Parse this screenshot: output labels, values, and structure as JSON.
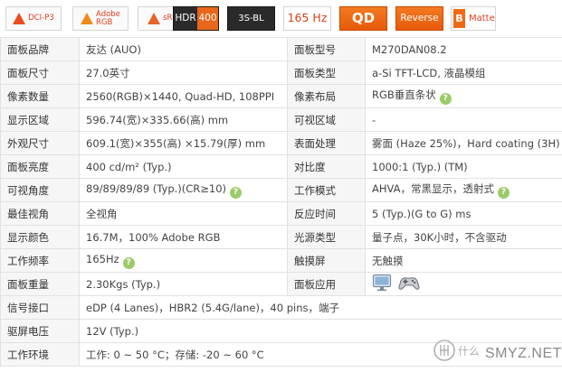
{
  "badges": {
    "dci_p3": "DCI-P3",
    "adobe_rgb_line1": "Adobe",
    "adobe_rgb_line2": "RGB",
    "srgb": "sRGB",
    "hdr_a": "HDR",
    "hdr_b": "400",
    "bl": "3S-BL",
    "hz": "165 Hz",
    "qd": "QD",
    "reverse": "Reverse",
    "matte_letter": "B",
    "matte": "Matte"
  },
  "specs": {
    "rows": [
      {
        "l1": "面板品牌",
        "v1": "友达 (AUO)",
        "l2": "面板型号",
        "v2": "M270DAN08.2"
      },
      {
        "l1": "面板尺寸",
        "v1": "27.0英寸",
        "l2": "面板类型",
        "v2": "a-Si TFT-LCD, 液晶模组"
      },
      {
        "l1": "像素数量",
        "v1": "2560(RGB)×1440, Quad-HD, 108PPI",
        "l2": "像素布局",
        "v2": "RGB垂直条状"
      },
      {
        "l1": "显示区域",
        "v1": "596.74(宽)×335.66(高) mm",
        "l2": "可视区域",
        "v2": "-"
      },
      {
        "l1": "外观尺寸",
        "v1": "609.1(宽)×355(高) ×15.79(厚) mm",
        "l2": "表面处理",
        "v2": "雾面 (Haze 25%)，Hard coating (3H)"
      },
      {
        "l1": "面板亮度",
        "v1": "400 cd/m² (Typ.)",
        "l2": "对比度",
        "v2": "1000:1 (Typ.) (TM)"
      },
      {
        "l1": "可视角度",
        "v1": "89/89/89/89 (Typ.)(CR≥10)",
        "l2": "工作模式",
        "v2": "AHVA，常黑显示，透射式"
      },
      {
        "l1": "最佳视角",
        "v1": "全视角",
        "l2": "反应时间",
        "v2": "5 (Typ.)(G to G) ms"
      },
      {
        "l1": "显示颜色",
        "v1": "16.7M，100% Adobe RGB",
        "l2": "光源类型",
        "v2": "量子点，30K小时，不含驱动"
      },
      {
        "l1": "工作频率",
        "v1": "165Hz",
        "l2": "触摸屏",
        "v2": "无触摸"
      },
      {
        "l1": "面板重量",
        "v1": "2.30Kgs (Typ.)",
        "l2": "面板应用",
        "v2": ""
      }
    ],
    "interface_label": "信号接口",
    "interface_value": "eDP (4 Lanes)，HBR2 (5.4G/lane)，40 pins，端子",
    "voltage_label": "驱屏电压",
    "voltage_value": "12V (Typ.)",
    "env_label": "工作环境",
    "env_value": "工作: 0 ~ 50 °C；存储: -20 ~ 60 °C"
  },
  "icons": {
    "help": "question-help-icon",
    "app_monitor": "monitor-icon",
    "app_gamepad": "gamepad-icon"
  },
  "watermark": {
    "text": "SMYZ.NET",
    "logo": "值 什么值得买"
  },
  "colors": {
    "label_bg": "#f6f6f6",
    "border": "#e2e2e2",
    "help_green": "#9ccb6a",
    "badge_orange": "#f06a14",
    "hz_red": "#d8401a"
  }
}
